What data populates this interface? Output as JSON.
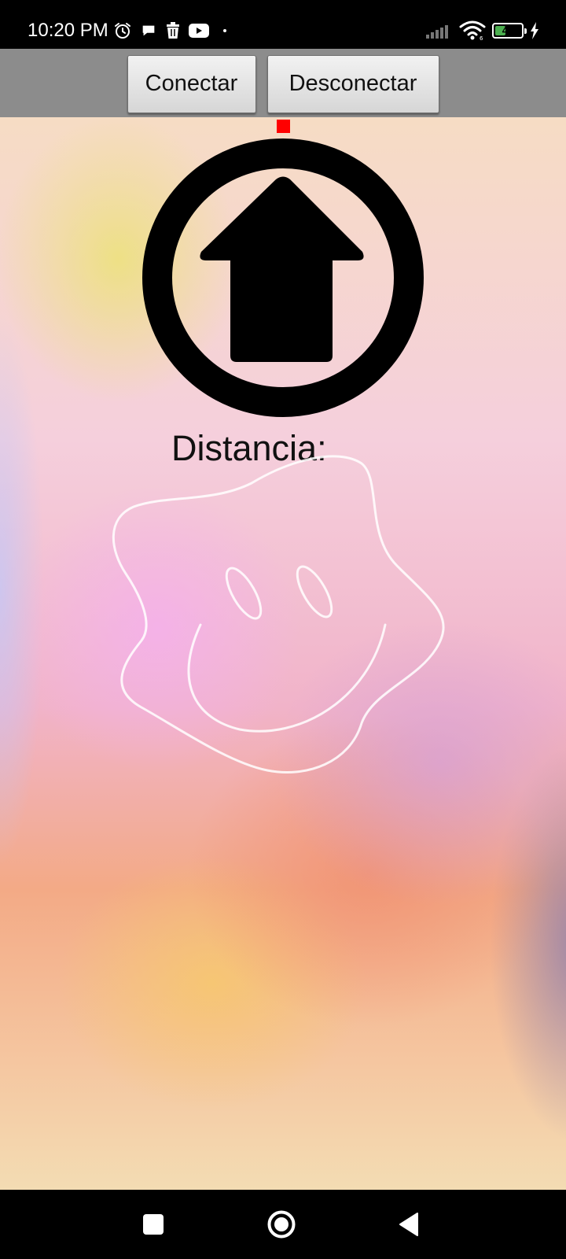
{
  "status_bar": {
    "time": "10:20 PM",
    "battery_level": "41",
    "battery_fraction": 0.41,
    "icons_left": [
      "alarm-icon",
      "chat-bubble-icon",
      "trash-icon",
      "youtube-icon",
      "dot-icon"
    ],
    "icons_right": [
      "signal-icon",
      "wifi-icon",
      "battery-icon",
      "charging-icon"
    ]
  },
  "toolbar": {
    "connect_label": "Conectar",
    "disconnect_label": "Desconectar"
  },
  "main": {
    "forward_button_icon": "up-arrow-circle-icon",
    "indicator_color": "#ff0000",
    "distance_label": "Distancia:",
    "background_art": "smiley-doodle"
  },
  "nav_bar": {
    "buttons": [
      "recents-icon",
      "home-icon",
      "back-icon"
    ]
  },
  "colors": {
    "toolbar_bg": "#8c8c8c",
    "system_bars": "#000000",
    "battery_fill": "#4caf50"
  }
}
